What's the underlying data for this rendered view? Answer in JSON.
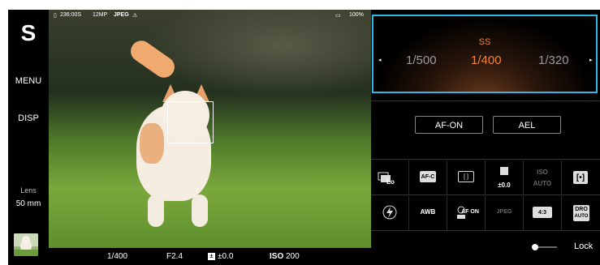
{
  "sidebar": {
    "mode": "S",
    "menu_label": "MENU",
    "disp_label": "DISP",
    "lens_label": "Lens",
    "lens_value": "50 mm"
  },
  "status": {
    "shots_remaining": "236:00S",
    "resolution": "12MP",
    "format": "JPEG",
    "battery": "100%"
  },
  "viewfinder_bottom": {
    "shutter_speed": "1/400",
    "aperture": "F2.4",
    "exposure_comp": "±0.0",
    "iso_label": "ISO",
    "iso_value": "200"
  },
  "shutter_selector": {
    "label": "SS",
    "values": [
      "1/500",
      "1/400",
      "1/320"
    ],
    "selected_index": 1,
    "accent_color": "#f0862f",
    "border_color": "#2fb7ea"
  },
  "buttons": {
    "af_on": "AF-ON",
    "ael": "AEL"
  },
  "settings_row1": {
    "drive_suffix": "Lo",
    "focus_mode": "AF-C",
    "focus_area": "[ ]",
    "ev_value": "±0.0",
    "iso_label": "ISO",
    "iso_value": "AUTO",
    "metering": "[•]"
  },
  "settings_row2": {
    "flash": "⚡",
    "wb": "AWB",
    "face_eye": "Face/Eye AF ON",
    "face_eye_short": "AF ON",
    "file_format": "JPEG",
    "aspect": "4:3",
    "dro": "DRO AUTO",
    "dro_top": "DRO",
    "dro_bottom": "AUTO"
  },
  "lock_label": "Lock"
}
